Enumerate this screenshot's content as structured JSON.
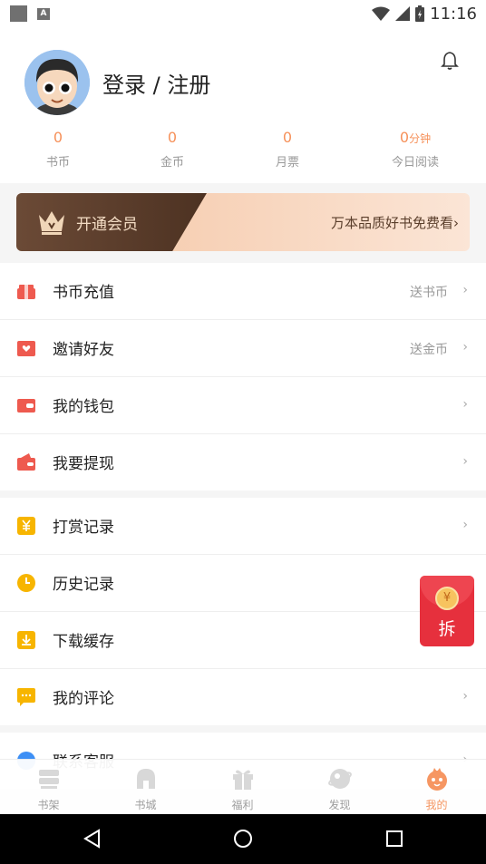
{
  "status_bar": {
    "time": "11:16",
    "notif_badge": "A"
  },
  "header": {
    "login_label": "登录 / 注册",
    "stats": [
      {
        "value": "0",
        "unit": "",
        "label": "书币"
      },
      {
        "value": "0",
        "unit": "",
        "label": "金币"
      },
      {
        "value": "0",
        "unit": "",
        "label": "月票"
      },
      {
        "value": "0",
        "unit": "分钟",
        "label": "今日阅读"
      }
    ]
  },
  "vip": {
    "open_label": "开通会员",
    "promo": "万本品质好书免费看",
    "arrow": "›"
  },
  "menu_group1": [
    {
      "label": "书币充值",
      "sub": "送书币",
      "icon": "gift-box-icon"
    },
    {
      "label": "邀请好友",
      "sub": "送金币",
      "icon": "invite-envelope-icon"
    },
    {
      "label": "我的钱包",
      "sub": "",
      "icon": "wallet-icon"
    },
    {
      "label": "我要提现",
      "sub": "",
      "icon": "withdraw-icon"
    }
  ],
  "menu_group2": [
    {
      "label": "打赏记录",
      "sub": "",
      "icon": "reward-icon"
    },
    {
      "label": "历史记录",
      "sub": "",
      "icon": "clock-icon"
    },
    {
      "label": "下载缓存",
      "sub": "",
      "icon": "download-icon"
    },
    {
      "label": "我的评论",
      "sub": "",
      "icon": "comment-icon"
    }
  ],
  "menu_group3": [
    {
      "label": "联系客服",
      "sub": "",
      "icon": "service-icon"
    }
  ],
  "arrow": "›",
  "red_packet": {
    "coin": "¥",
    "label": "拆"
  },
  "tabs": [
    {
      "label": "书架"
    },
    {
      "label": "书城"
    },
    {
      "label": "福利"
    },
    {
      "label": "发现"
    },
    {
      "label": "我的"
    }
  ],
  "colors": {
    "accent": "#f6915a",
    "red": "#e6303d",
    "yellow": "#f7b500"
  }
}
